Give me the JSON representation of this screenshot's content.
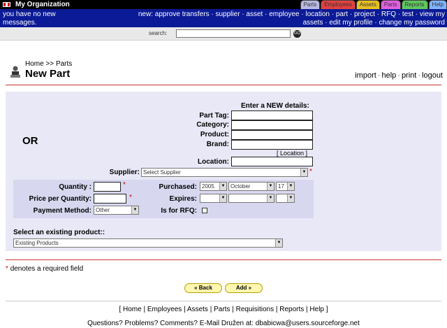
{
  "topbar": {
    "org": "My Organization",
    "tabs": [
      {
        "label": "Parts",
        "color": "#b9b9e3"
      },
      {
        "label": "Employees",
        "color": "#e24040"
      },
      {
        "label": "Assets",
        "color": "#e8c020"
      },
      {
        "label": "Parts",
        "color": "#e060e0"
      },
      {
        "label": "Reports",
        "color": "#5ec85e"
      },
      {
        "label": "Help",
        "color": "#7fb3ff"
      }
    ]
  },
  "bluebar": {
    "message": "you have no new messages.",
    "nav_line1": [
      "new:",
      "approve transfers",
      "supplier",
      "asset",
      "employee",
      "location",
      "part",
      "project",
      "RFQ",
      "test",
      "view my"
    ],
    "nav_line2": [
      "assets",
      "edit my profile",
      "change my password"
    ]
  },
  "search": {
    "label": "search:",
    "value": "",
    "go_label": "GO"
  },
  "header": {
    "breadcrumb_home": "Home",
    "breadcrumb_sep": ">>",
    "breadcrumb_parts": "Parts",
    "title": "New Part",
    "links": [
      "import",
      "help",
      "print",
      "logout"
    ]
  },
  "form": {
    "enter_heading": "Enter a NEW details:",
    "or_label": "OR",
    "part_tag_label": "Part Tag:",
    "category_label": "Category:",
    "product_label": "Product:",
    "brand_label": "Brand:",
    "location_button": "[ Location ]",
    "location_label": "Location:",
    "supplier_label": "Supplier:",
    "supplier_value": "Select Supplier",
    "quantity_label": "Quantity :",
    "price_label": "Price per Quantity:",
    "payment_label": "Payment Method:",
    "payment_value": "Other",
    "purchased_label": "Purchased:",
    "purchased_year": "2005",
    "purchased_month": "October",
    "purchased_day": "17",
    "expires_label": "Expires:",
    "rfq_label": "Is for RFQ:",
    "required_mark": "*",
    "existing_label": "Select an existing product::",
    "existing_value": "Existing Products"
  },
  "required_note": "denotes a required field",
  "buttons": {
    "back": "« Back",
    "add": "Add »"
  },
  "footer": {
    "links": [
      "Home",
      "Employees",
      "Assets",
      "Parts",
      "Requisitions",
      "Reports",
      "Help"
    ],
    "contact_text": "Questions? Problems? Comments? E-Mail Družen at:",
    "email": "dbabicwa@users.sourceforge.net"
  }
}
